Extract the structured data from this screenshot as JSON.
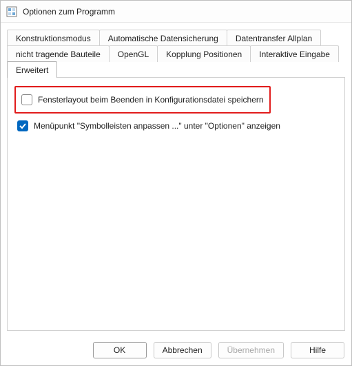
{
  "window": {
    "title": "Optionen zum Programm"
  },
  "tabs": {
    "row1": [
      {
        "label": "Konstruktionsmodus"
      },
      {
        "label": "Automatische Datensicherung"
      },
      {
        "label": "Datentransfer Allplan"
      }
    ],
    "row2": [
      {
        "label": "nicht tragende Bauteile"
      },
      {
        "label": "OpenGL"
      },
      {
        "label": "Kopplung Positionen"
      },
      {
        "label": "Interaktive Eingabe"
      },
      {
        "label": "Erweitert",
        "active": true
      }
    ]
  },
  "options": [
    {
      "label": "Fensterlayout beim Beenden in Konfigurationsdatei speichern",
      "checked": false,
      "highlight": true
    },
    {
      "label": "Menüpunkt \"Symbolleisten anpassen ...\" unter \"Optionen\" anzeigen",
      "checked": true,
      "highlight": false
    }
  ],
  "buttons": {
    "ok": "OK",
    "cancel": "Abbrechen",
    "apply": "Übernehmen",
    "help": "Hilfe"
  }
}
